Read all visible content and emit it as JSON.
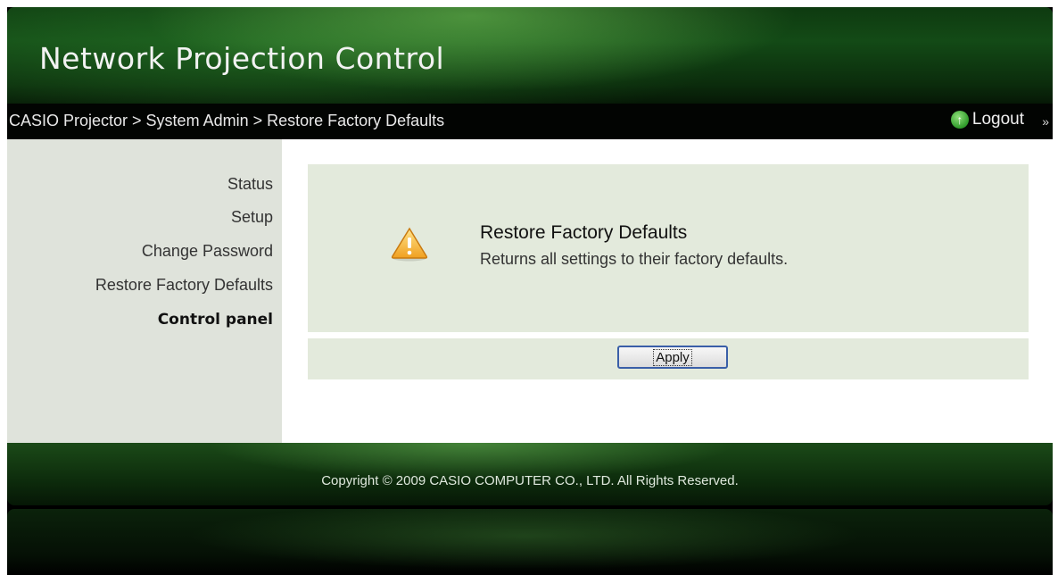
{
  "header": {
    "title": "Network Projection Control"
  },
  "breadcrumb": {
    "text": "CASIO Projector > System Admin > Restore Factory Defaults",
    "logout_label": "Logout"
  },
  "sidebar": {
    "items": [
      {
        "label": "Status"
      },
      {
        "label": "Setup"
      },
      {
        "label": "Change Password"
      },
      {
        "label": "Restore Factory Defaults"
      },
      {
        "label": "Control panel"
      }
    ]
  },
  "main": {
    "title": "Restore Factory Defaults",
    "description": "Returns all settings to their factory defaults.",
    "apply_label": "Apply"
  },
  "footer": {
    "copyright": "Copyright © 2009 CASIO COMPUTER CO., LTD. All Rights Reserved."
  },
  "icons": {
    "logout": "up-arrow-circle-icon",
    "more": "double-chevron-right-icon",
    "warning": "warning-triangle-icon"
  },
  "colors": {
    "banner_green": "#134a16",
    "panel_bg": "#e3eadc",
    "sidebar_bg": "#dfe3db"
  }
}
